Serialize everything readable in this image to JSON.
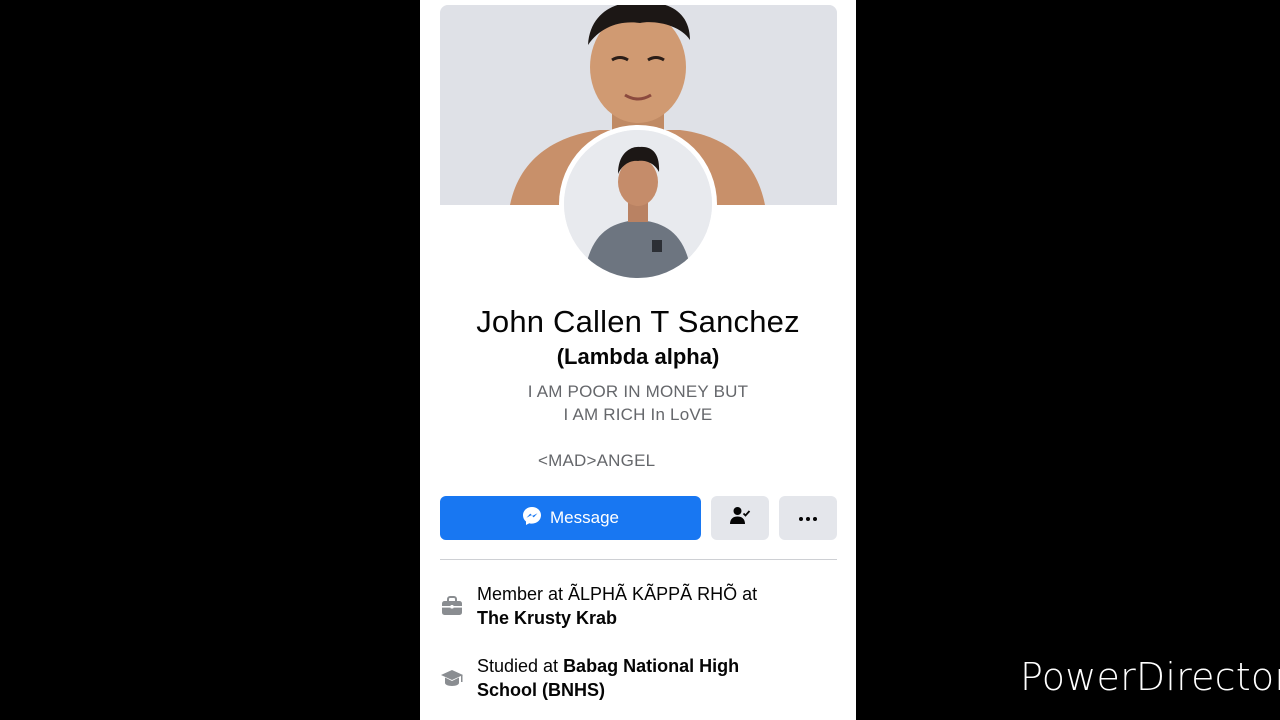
{
  "profile": {
    "name": "John Callen T Sanchez",
    "nickname": "(Lambda alpha)",
    "bio_line1": "I AM POOR IN MONEY BUT",
    "bio_line2": "I AM RICH In LoVE",
    "bio_line3": "<MAD>ANGEL"
  },
  "actions": {
    "message_label": "Message",
    "friend_icon": "person-check-icon",
    "more_icon": "more-dots-icon"
  },
  "intro": {
    "work_prefix": "Member at ÃLPHÃ KÃPPÃ RHÕ at",
    "work_place": "The Krusty Krab",
    "work_icon": "briefcase-icon",
    "edu_prefix": "Studied at ",
    "edu_school_a": "Babag National High",
    "edu_school_b": "School (BNHS)",
    "edu_icon": "graduation-cap-icon"
  },
  "watermark": "PowerDirector",
  "colors": {
    "primary": "#1877f2",
    "secondary_btn": "#e4e6eb",
    "muted_text": "#65676b"
  }
}
